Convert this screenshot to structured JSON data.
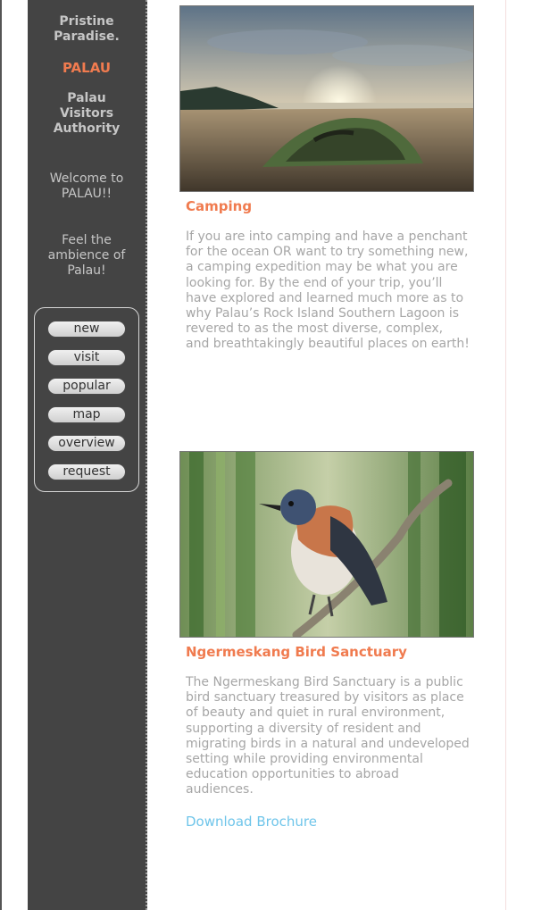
{
  "sidebar": {
    "tagline": [
      "Pristine",
      "Paradise."
    ],
    "destination": "PALAU",
    "authority": [
      "Palau",
      "Visitors",
      "Authority"
    ],
    "welcome": [
      "Welcome to",
      "PALAU!!"
    ],
    "feel": [
      "Feel the",
      "ambience of",
      "Palau!"
    ],
    "nav": [
      "new",
      "visit",
      "popular",
      "map",
      "overview",
      "request"
    ]
  },
  "sections": [
    {
      "title": "Camping",
      "body": "If you are into camping and have a penchant for the ocean OR want to try something new, a camping expedition may be what you are looking for. By the end of your trip, you’ll have explored and learned much more as to why Palau’s Rock Island Southern Lagoon is revered to as the most diverse, complex, and breathtakingly beautiful places on earth!"
    },
    {
      "title": "Ngermeskang Bird Sanctuary",
      "body": "The Ngermeskang Bird Sanctuary is a public bird sanctuary treasured by visitors as place of beauty and quiet in rural environment, supporting a diversity of resident and migrating birds in a natural and undeveloped setting while providing environmental education opportunities to abroad audiences."
    }
  ],
  "download_label": "Download Brochure"
}
